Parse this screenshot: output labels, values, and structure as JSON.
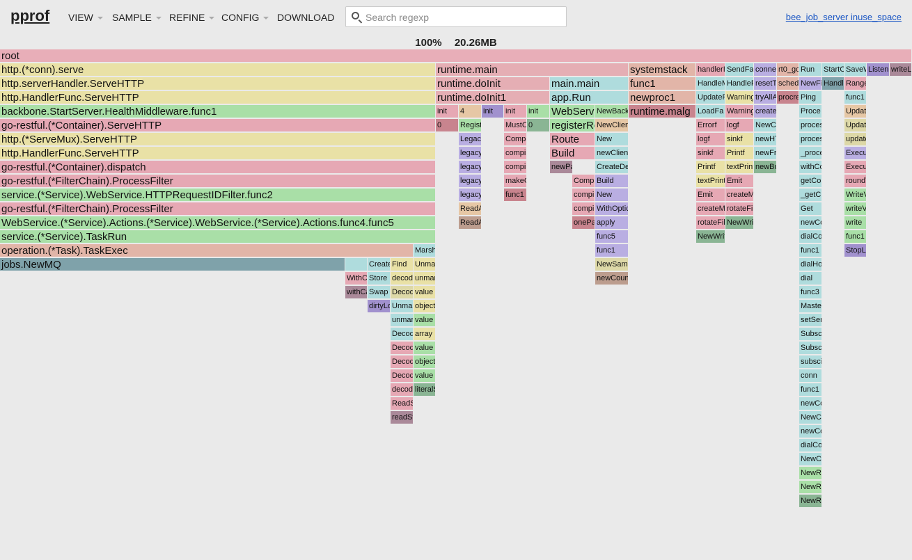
{
  "header": {
    "logo": "pprof",
    "menus": [
      "VIEW",
      "SAMPLE",
      "REFINE",
      "CONFIG",
      "DOWNLOAD"
    ],
    "search_placeholder": "Search regexp",
    "search_value": "",
    "profile_name": "bee_job_server inuse_space"
  },
  "summary": {
    "percent": "100%",
    "total": "20.26MB"
  },
  "palette": {
    "pink": "#e6a8b4",
    "yellow": "#e9e1a6",
    "green": "#a9dfa7",
    "teal": "#7fa2aa",
    "red": "#c8848e",
    "lightblue": "#afdcdd",
    "purple": "#b9aee2",
    "salmon": "#e2b5a8",
    "olive": "#ddd8a7",
    "darkgreen": "#8ab594",
    "mauve": "#aa8999",
    "peach": "#e6c7a5",
    "brown": "#bc9d8e",
    "violet": "#a191ce",
    "root": "#e8aeb8",
    "dusty": "#e5aeb4"
  },
  "frames": [
    {
      "l": "root",
      "c": "root"
    },
    {
      "l": "http.(*conn).serve",
      "c": "yellow"
    },
    {
      "l": "http.serverHandler.ServeHTTP",
      "c": "yellow"
    },
    {
      "l": "http.HandlerFunc.ServeHTTP",
      "c": "yellow"
    },
    {
      "l": "backbone.StartServer.HealthMiddleware.func1",
      "c": "green"
    },
    {
      "l": "go-restful.(*Container).ServeHTTP",
      "c": "pink"
    },
    {
      "l": "http.(*ServeMux).ServeHTTP",
      "c": "yellow"
    },
    {
      "l": "http.HandlerFunc.ServeHTTP",
      "c": "yellow"
    },
    {
      "l": "go-restful.(*Container).dispatch",
      "c": "pink"
    },
    {
      "l": "go-restful.(*FilterChain).ProcessFilter",
      "c": "pink"
    },
    {
      "l": "service.(*Service).WebService.HTTPRequestIDFilter.func2",
      "c": "green"
    },
    {
      "l": "go-restful.(*FilterChain).ProcessFilter",
      "c": "pink"
    },
    {
      "l": "WebService.(*Service).Actions.(*Service).WebService.(*Service).Actions.func4.func5",
      "c": "green"
    },
    {
      "l": "service.(*Service).TaskRun",
      "c": "green"
    },
    {
      "l": "operation.(*Task).TaskExec",
      "c": "salmon"
    },
    {
      "l": "jobs.NewMQ",
      "c": "teal"
    },
    {
      "l": "Marsh",
      "c": "lightblue"
    },
    {
      "l": "",
      "c": "lightblue"
    },
    {
      "l": "Create",
      "c": "lightblue"
    },
    {
      "l": "Find",
      "c": "yellow"
    },
    {
      "l": "Unma",
      "c": "yellow"
    },
    {
      "l": "WithC",
      "c": "pink"
    },
    {
      "l": "Store",
      "c": "lightblue"
    },
    {
      "l": "decod",
      "c": "yellow"
    },
    {
      "l": "unmar",
      "c": "yellow"
    },
    {
      "l": "withCa",
      "c": "mauve"
    },
    {
      "l": "Swap",
      "c": "lightblue"
    },
    {
      "l": "Decod",
      "c": "olive"
    },
    {
      "l": "value",
      "c": "yellow"
    },
    {
      "l": "dirtyLo",
      "c": "violet"
    },
    {
      "l": "Unma",
      "c": "lightblue"
    },
    {
      "l": "object",
      "c": "yellow"
    },
    {
      "l": "unmar",
      "c": "lightblue"
    },
    {
      "l": "value",
      "c": "green"
    },
    {
      "l": "Decod",
      "c": "lightblue"
    },
    {
      "l": "array",
      "c": "yellow"
    },
    {
      "l": "Decod",
      "c": "pink"
    },
    {
      "l": "value",
      "c": "green"
    },
    {
      "l": "Decod",
      "c": "pink"
    },
    {
      "l": "object",
      "c": "green"
    },
    {
      "l": "Decod",
      "c": "pink"
    },
    {
      "l": "value",
      "c": "green"
    },
    {
      "l": "decod",
      "c": "pink"
    },
    {
      "l": "literalS",
      "c": "darkgreen"
    },
    {
      "l": "ReadS",
      "c": "pink"
    },
    {
      "l": "readSt",
      "c": "mauve"
    },
    {
      "l": "runtime.main",
      "c": "dusty"
    },
    {
      "l": "runtime.doInit",
      "c": "dusty"
    },
    {
      "l": "runtime.doInit1",
      "c": "dusty"
    },
    {
      "l": "init",
      "c": "pink"
    },
    {
      "l": "4",
      "c": "peach"
    },
    {
      "l": "init",
      "c": "violet"
    },
    {
      "l": "init",
      "c": "pink"
    },
    {
      "l": "init",
      "c": "green"
    },
    {
      "l": "0",
      "c": "red"
    },
    {
      "l": "Regist",
      "c": "green"
    },
    {
      "l": "MustC",
      "c": "pink"
    },
    {
      "l": "0",
      "c": "darkgreen"
    },
    {
      "l": "Legac",
      "c": "purple"
    },
    {
      "l": "Comp",
      "c": "pink"
    },
    {
      "l": "legacy",
      "c": "purple"
    },
    {
      "l": "compi",
      "c": "pink"
    },
    {
      "l": "legacy",
      "c": "purple"
    },
    {
      "l": "compi",
      "c": "pink"
    },
    {
      "l": "legacy",
      "c": "purple"
    },
    {
      "l": "makeC",
      "c": "pink"
    },
    {
      "l": "legacy",
      "c": "purple"
    },
    {
      "l": "func1",
      "c": "red"
    },
    {
      "l": "ReadA",
      "c": "peach"
    },
    {
      "l": "ReadA",
      "c": "brown"
    },
    {
      "l": "main.main",
      "c": "lightblue"
    },
    {
      "l": "app.Run",
      "c": "lightblue"
    },
    {
      "l": "WebService",
      "c": "green"
    },
    {
      "l": "NewBack",
      "c": "green"
    },
    {
      "l": "registerRoute",
      "c": "green"
    },
    {
      "l": "NewClien",
      "c": "peach"
    },
    {
      "l": "Route",
      "c": "pink"
    },
    {
      "l": "New",
      "c": "lightblue"
    },
    {
      "l": "Build",
      "c": "pink"
    },
    {
      "l": "newClient",
      "c": "lightblue"
    },
    {
      "l": "newPathExpr",
      "c": "mauve"
    },
    {
      "l": "CreateDe",
      "c": "lightblue"
    },
    {
      "l": "Compi",
      "c": "pink"
    },
    {
      "l": "Build",
      "c": "purple"
    },
    {
      "l": "compi",
      "c": "pink"
    },
    {
      "l": "New",
      "c": "purple"
    },
    {
      "l": "compi",
      "c": "pink"
    },
    {
      "l": "WithOptic",
      "c": "purple"
    },
    {
      "l": "onePa",
      "c": "red"
    },
    {
      "l": "apply",
      "c": "purple"
    },
    {
      "l": "func5",
      "c": "purple"
    },
    {
      "l": "func1",
      "c": "purple"
    },
    {
      "l": "NewSamp",
      "c": "olive"
    },
    {
      "l": "newCoun",
      "c": "brown"
    },
    {
      "l": "systemstack",
      "c": "salmon"
    },
    {
      "l": "func1",
      "c": "salmon"
    },
    {
      "l": "newproc1",
      "c": "salmon"
    },
    {
      "l": "runtime.malg",
      "c": "red"
    },
    {
      "l": "handlerI",
      "c": "pink"
    },
    {
      "l": "SendFa",
      "c": "lightblue"
    },
    {
      "l": "conne",
      "c": "purple"
    },
    {
      "l": "rt0_go",
      "c": "salmon"
    },
    {
      "l": "Run",
      "c": "lightblue"
    },
    {
      "l": "StartC",
      "c": "lightblue"
    },
    {
      "l": "SaveW",
      "c": "lightblue"
    },
    {
      "l": "Listen",
      "c": "violet"
    },
    {
      "l": "writeL",
      "c": "mauve"
    },
    {
      "l": "HandleM",
      "c": "lightblue"
    },
    {
      "l": "HandleF",
      "c": "lightblue"
    },
    {
      "l": "resetT",
      "c": "purple"
    },
    {
      "l": "sched",
      "c": "salmon"
    },
    {
      "l": "NewFi",
      "c": "purple"
    },
    {
      "l": "Handl",
      "c": "teal"
    },
    {
      "l": "Range",
      "c": "pink"
    },
    {
      "l": "UpdateF",
      "c": "lightblue"
    },
    {
      "l": "Warning",
      "c": "yellow"
    },
    {
      "l": "tryAllA",
      "c": "purple"
    },
    {
      "l": "procre",
      "c": "red"
    },
    {
      "l": "Ping",
      "c": "lightblue"
    },
    {
      "l": "func1",
      "c": "lightblue"
    },
    {
      "l": "LoadFa",
      "c": "lightblue"
    },
    {
      "l": "Warning",
      "c": "pink"
    },
    {
      "l": "create",
      "c": "purple"
    },
    {
      "l": "Proce",
      "c": "lightblue"
    },
    {
      "l": "Updat",
      "c": "peach"
    },
    {
      "l": "Errorf",
      "c": "pink"
    },
    {
      "l": "logf",
      "c": "pink"
    },
    {
      "l": "NewCl",
      "c": "lightblue"
    },
    {
      "l": "proces",
      "c": "lightblue"
    },
    {
      "l": "Updat",
      "c": "olive"
    },
    {
      "l": "logf",
      "c": "pink"
    },
    {
      "l": "sinkf",
      "c": "yellow"
    },
    {
      "l": "newHT",
      "c": "lightblue"
    },
    {
      "l": "proces",
      "c": "lightblue"
    },
    {
      "l": "update",
      "c": "olive"
    },
    {
      "l": "sinkf",
      "c": "pink"
    },
    {
      "l": "Printf",
      "c": "yellow"
    },
    {
      "l": "newFr",
      "c": "lightblue"
    },
    {
      "l": "_proce",
      "c": "lightblue"
    },
    {
      "l": "Execu",
      "c": "purple"
    },
    {
      "l": "Printf",
      "c": "yellow"
    },
    {
      "l": "textPrint",
      "c": "yellow"
    },
    {
      "l": "newBu",
      "c": "darkgreen"
    },
    {
      "l": "withCo",
      "c": "lightblue"
    },
    {
      "l": "Execu",
      "c": "pink"
    },
    {
      "l": "textPrint",
      "c": "yellow"
    },
    {
      "l": "Emit",
      "c": "pink"
    },
    {
      "l": "getCo",
      "c": "lightblue"
    },
    {
      "l": "roundT",
      "c": "pink"
    },
    {
      "l": "Emit",
      "c": "pink"
    },
    {
      "l": "createM",
      "c": "pink"
    },
    {
      "l": "_getC",
      "c": "lightblue"
    },
    {
      "l": "WriteV",
      "c": "green"
    },
    {
      "l": "createM",
      "c": "pink"
    },
    {
      "l": "rotateFil",
      "c": "pink"
    },
    {
      "l": "Get",
      "c": "lightblue"
    },
    {
      "l": "writeV",
      "c": "green"
    },
    {
      "l": "rotateFil",
      "c": "pink"
    },
    {
      "l": "NewWrit",
      "c": "darkgreen"
    },
    {
      "l": "newCo",
      "c": "lightblue"
    },
    {
      "l": "write",
      "c": "green"
    },
    {
      "l": "NewWrit",
      "c": "darkgreen"
    },
    {
      "l": "dialCo",
      "c": "lightblue"
    },
    {
      "l": "func1",
      "c": "green"
    },
    {
      "l": "func1",
      "c": "lightblue"
    },
    {
      "l": "StopL",
      "c": "violet"
    },
    {
      "l": "dialHo",
      "c": "lightblue"
    },
    {
      "l": "dial",
      "c": "lightblue"
    },
    {
      "l": "func3",
      "c": "lightblue"
    },
    {
      "l": "Maste",
      "c": "lightblue"
    },
    {
      "l": "setSer",
      "c": "lightblue"
    },
    {
      "l": "Subsc",
      "c": "lightblue"
    },
    {
      "l": "Subsc",
      "c": "lightblue"
    },
    {
      "l": "subsci",
      "c": "lightblue"
    },
    {
      "l": "conn",
      "c": "lightblue"
    },
    {
      "l": "func1",
      "c": "lightblue"
    },
    {
      "l": "newCo",
      "c": "lightblue"
    },
    {
      "l": "NewC",
      "c": "lightblue"
    },
    {
      "l": "newCo",
      "c": "lightblue"
    },
    {
      "l": "dialCo",
      "c": "lightblue"
    },
    {
      "l": "NewC",
      "c": "lightblue"
    },
    {
      "l": "NewR",
      "c": "green"
    },
    {
      "l": "NewR",
      "c": "green"
    },
    {
      "l": "NewR",
      "c": "darkgreen"
    }
  ]
}
